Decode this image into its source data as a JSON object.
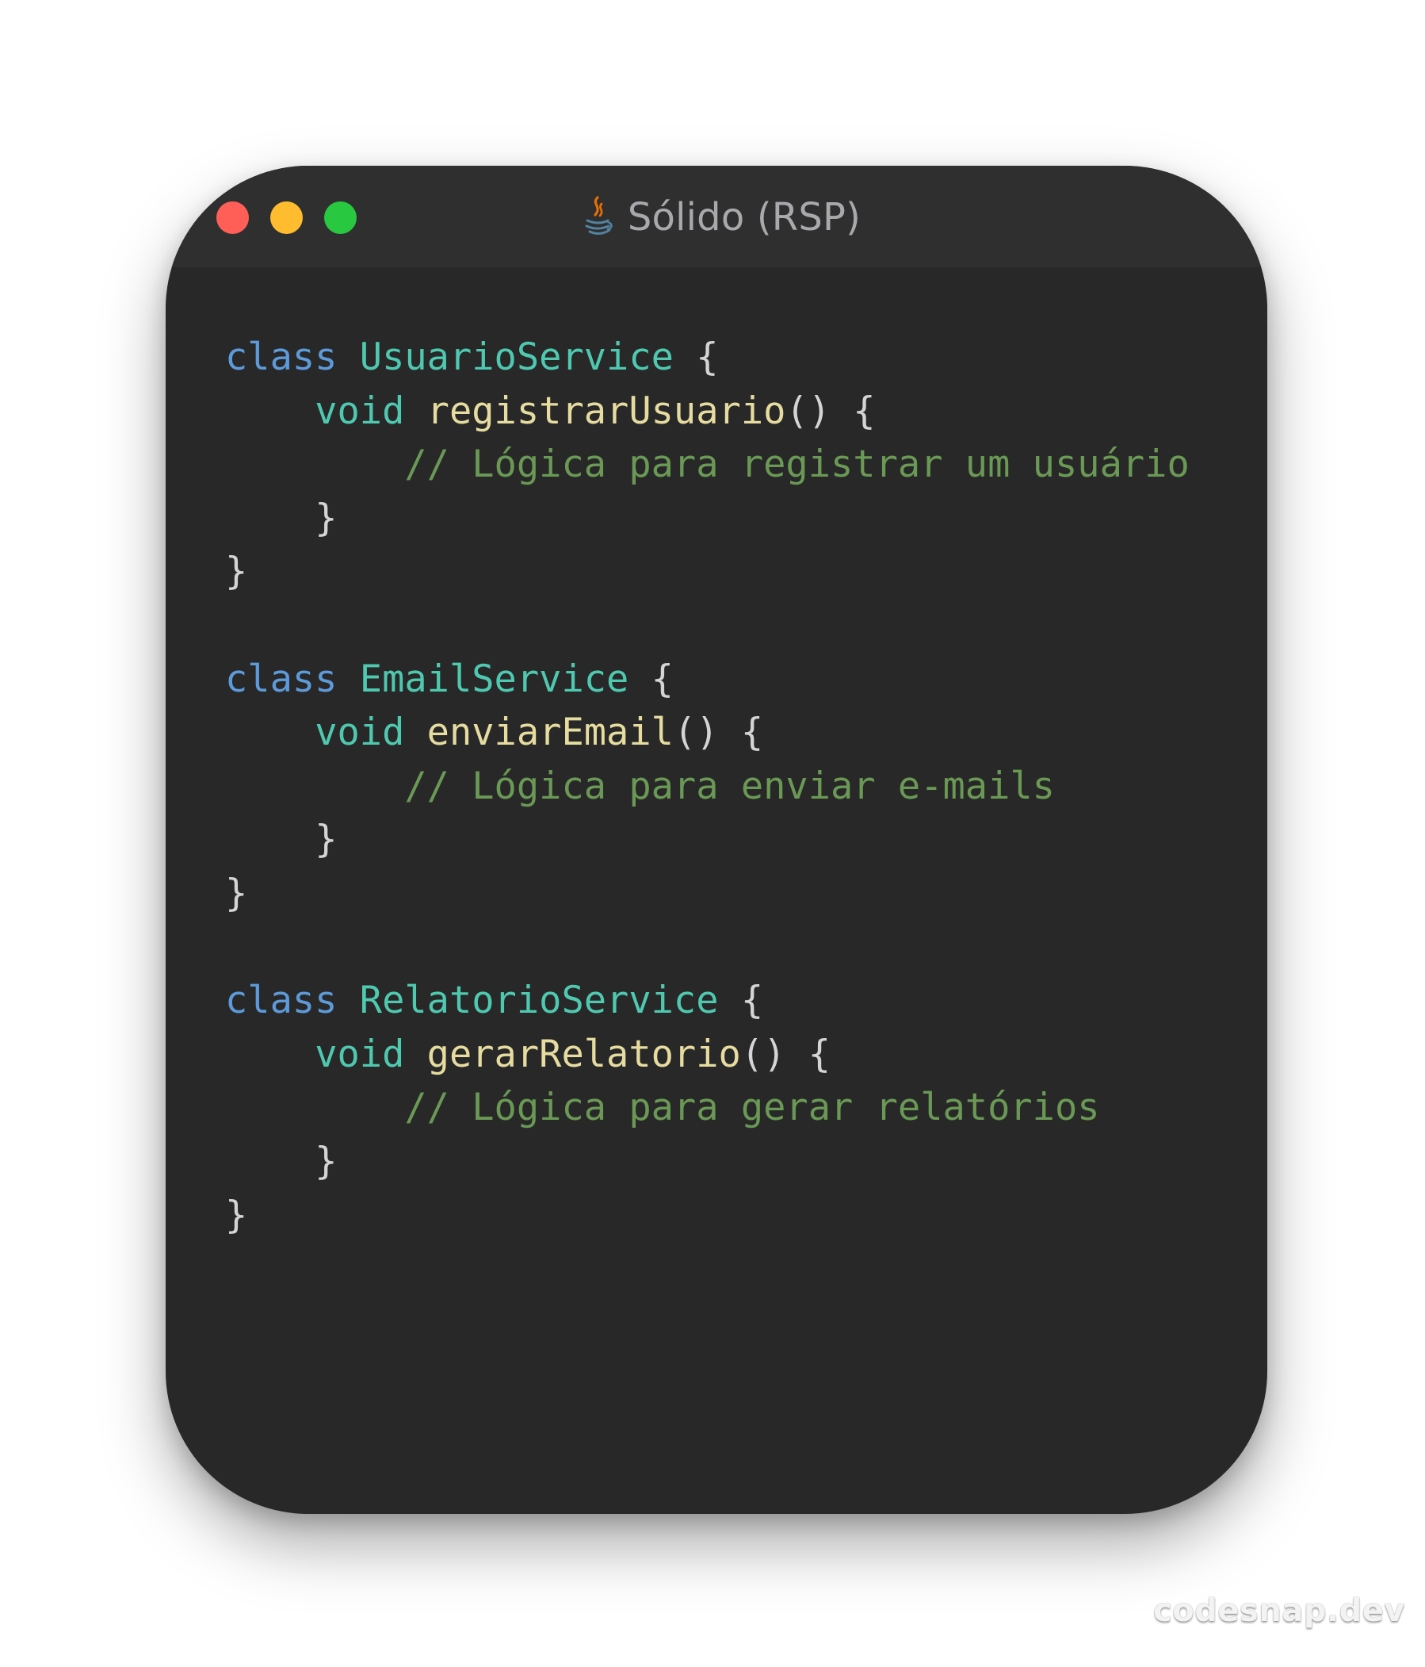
{
  "window": {
    "title": "Sólido (RSP)",
    "language_icon": "java-icon"
  },
  "code": {
    "lines": [
      [
        {
          "text": "class",
          "kind": "keyword"
        },
        {
          "text": " "
        },
        {
          "text": "UsuarioService",
          "kind": "class"
        },
        {
          "text": " {",
          "kind": "punct"
        }
      ],
      [
        {
          "text": "    "
        },
        {
          "text": "void",
          "kind": "type"
        },
        {
          "text": " "
        },
        {
          "text": "registrarUsuario",
          "kind": "function"
        },
        {
          "text": "() {",
          "kind": "punct"
        }
      ],
      [
        {
          "text": "        "
        },
        {
          "text": "// Lógica para registrar um usuário",
          "kind": "comment"
        }
      ],
      [
        {
          "text": "    "
        },
        {
          "text": "}",
          "kind": "punct"
        }
      ],
      [
        {
          "text": "}",
          "kind": "punct"
        }
      ],
      [],
      [
        {
          "text": "class",
          "kind": "keyword"
        },
        {
          "text": " "
        },
        {
          "text": "EmailService",
          "kind": "class"
        },
        {
          "text": " {",
          "kind": "punct"
        }
      ],
      [
        {
          "text": "    "
        },
        {
          "text": "void",
          "kind": "type"
        },
        {
          "text": " "
        },
        {
          "text": "enviarEmail",
          "kind": "function"
        },
        {
          "text": "() {",
          "kind": "punct"
        }
      ],
      [
        {
          "text": "        "
        },
        {
          "text": "// Lógica para enviar e-mails",
          "kind": "comment"
        }
      ],
      [
        {
          "text": "    "
        },
        {
          "text": "}",
          "kind": "punct"
        }
      ],
      [
        {
          "text": "}",
          "kind": "punct"
        }
      ],
      [],
      [
        {
          "text": "class",
          "kind": "keyword"
        },
        {
          "text": " "
        },
        {
          "text": "RelatorioService",
          "kind": "class"
        },
        {
          "text": " {",
          "kind": "punct"
        }
      ],
      [
        {
          "text": "    "
        },
        {
          "text": "void",
          "kind": "type"
        },
        {
          "text": " "
        },
        {
          "text": "gerarRelatorio",
          "kind": "function"
        },
        {
          "text": "() {",
          "kind": "punct"
        }
      ],
      [
        {
          "text": "        "
        },
        {
          "text": "// Lógica para gerar relatórios",
          "kind": "comment"
        }
      ],
      [
        {
          "text": "    "
        },
        {
          "text": "}",
          "kind": "punct"
        }
      ],
      [
        {
          "text": "}",
          "kind": "punct"
        }
      ]
    ]
  },
  "watermark": "codesnap.dev",
  "colors": {
    "background": "#ffffff",
    "window": "#282828",
    "titlebar": "#2f2f2f",
    "close": "#ff5f57",
    "minimize": "#febc2e",
    "maximize": "#28c840",
    "keyword": "#5d9ad9",
    "class": "#4ec9b0",
    "function": "#e6dca0",
    "comment": "#6a9955",
    "text": "#d4d4d4"
  }
}
